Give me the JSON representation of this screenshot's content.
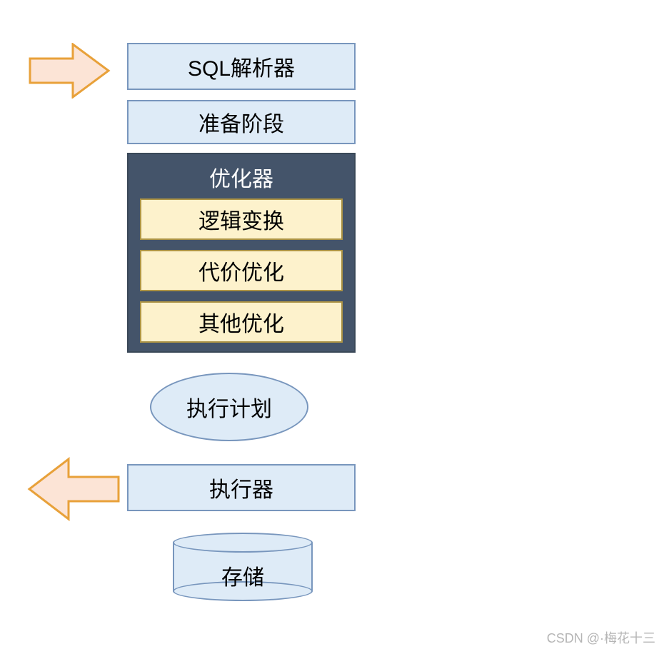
{
  "diagram": {
    "sql_parser": "SQL解析器",
    "preparation": "准备阶段",
    "optimizer": {
      "title": "优化器",
      "items": [
        "逻辑变换",
        "代价优化",
        "其他优化"
      ]
    },
    "execution_plan": "执行计划",
    "executor": "执行器",
    "storage": "存储"
  },
  "arrows": {
    "input": "input-arrow",
    "output": "output-arrow"
  },
  "colors": {
    "blue_fill": "#deebf7",
    "blue_border": "#7896bd",
    "dark_fill": "#44546a",
    "yellow_fill": "#fdf2cc",
    "yellow_border": "#ad9445",
    "arrow_fill": "#fce4d6",
    "arrow_border": "#e8a13a"
  },
  "watermark": "CSDN @·梅花十三"
}
